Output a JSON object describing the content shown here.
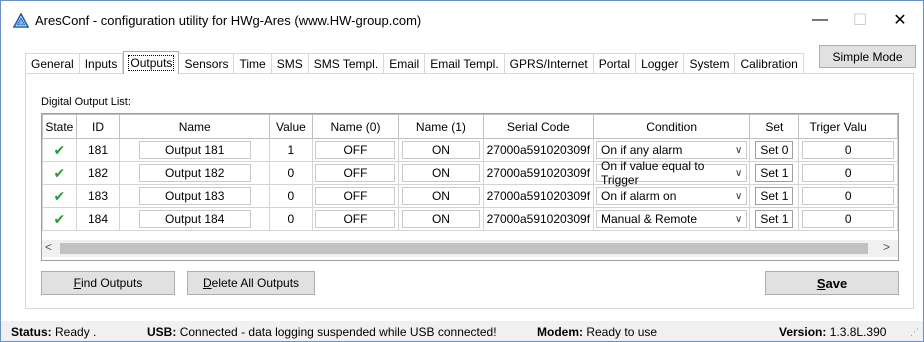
{
  "window": {
    "title": "AresConf - configuration utility for HWg-Ares (www.HW-group.com)",
    "minimize": "—",
    "maximize": "☐",
    "close": "✕",
    "app_icon": "triangle-logo-icon"
  },
  "simple_mode_label": "Simple Mode",
  "tabs": [
    {
      "label": "General"
    },
    {
      "label": "Inputs"
    },
    {
      "label": "Outputs",
      "active": true
    },
    {
      "label": "Sensors"
    },
    {
      "label": "Time"
    },
    {
      "label": "SMS"
    },
    {
      "label": "SMS Templ."
    },
    {
      "label": "Email"
    },
    {
      "label": "Email Templ."
    },
    {
      "label": "GPRS/Internet"
    },
    {
      "label": "Portal"
    },
    {
      "label": "Logger"
    },
    {
      "label": "System"
    },
    {
      "label": "Calibration"
    }
  ],
  "output_list": {
    "label": "Digital Output List:",
    "columns": [
      "State",
      "ID",
      "Name",
      "Value",
      "Name (0)",
      "Name (1)",
      "Serial Code",
      "Condition",
      "Set",
      "Triger Valu"
    ],
    "rows": [
      {
        "state_icon": "check-icon",
        "id": "181",
        "name": "Output 181",
        "value": "1",
        "name0": "OFF",
        "name1": "ON",
        "serial": "27000a591020309f",
        "condition": "On if any alarm",
        "set": "Set 0",
        "trigger": "0"
      },
      {
        "state_icon": "check-icon",
        "id": "182",
        "name": "Output 182",
        "value": "0",
        "name0": "OFF",
        "name1": "ON",
        "serial": "27000a591020309f",
        "condition": "On if value equal to Trigger",
        "set": "Set 1",
        "trigger": "0"
      },
      {
        "state_icon": "check-icon",
        "id": "183",
        "name": "Output 183",
        "value": "0",
        "name0": "OFF",
        "name1": "ON",
        "serial": "27000a591020309f",
        "condition": "On if alarm on",
        "set": "Set 1",
        "trigger": "0"
      },
      {
        "state_icon": "check-icon",
        "id": "184",
        "name": "Output 184",
        "value": "0",
        "name0": "OFF",
        "name1": "ON",
        "serial": "27000a591020309f",
        "condition": "Manual & Remote",
        "set": "Set 1",
        "trigger": "0"
      }
    ]
  },
  "buttons": {
    "find_mnemonic": "F",
    "find_rest": "ind Outputs",
    "delete_mnemonic": "D",
    "delete_rest": "elete All Outputs",
    "save_mnemonic": "S",
    "save_rest": "ave"
  },
  "status": {
    "status_label": "Status:",
    "status_value": "Ready .",
    "usb_label": "USB:",
    "usb_value": "Connected - data logging suspended while USB connected!",
    "modem_label": "Modem:",
    "modem_value": "Ready to use",
    "version_label": "Version:",
    "version_value": "1.3.8L.390"
  },
  "colors": {
    "check": "#2e9b2e",
    "window_border": "#6a8fc8",
    "button_face": "#e1e1e1"
  }
}
